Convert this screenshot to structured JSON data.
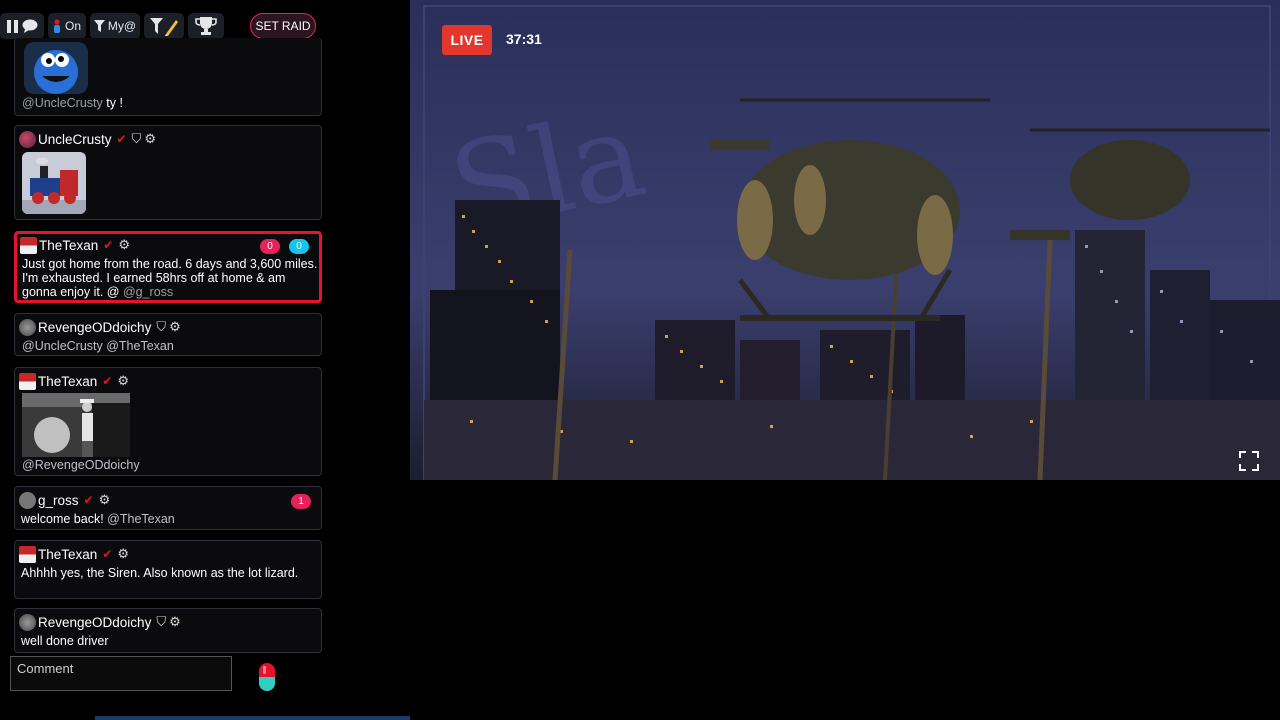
{
  "toolbar": {
    "online_label": "On",
    "mentions_label": "My@",
    "raid_label": "SET RAID"
  },
  "messages": [
    {
      "id": "m0",
      "mention": "@UncleCrusty",
      "text": "ty !"
    },
    {
      "id": "m1",
      "user": "UncleCrusty"
    },
    {
      "id": "m2",
      "user": "TheTexan",
      "text": "Just got home from the road. 6 days and 3,600 miles. I'm exhausted. I earned 58hrs off at home & am gonna enjoy it. @",
      "mention": "@g_ross",
      "badge_red": "0",
      "badge_cyan": "0"
    },
    {
      "id": "m3",
      "user": "RevengeODdoichy",
      "mention": "@UncleCrusty @TheTexan"
    },
    {
      "id": "m4",
      "user": "TheTexan",
      "mention": "@RevengeODdoichy"
    },
    {
      "id": "m5",
      "user": "g_ross",
      "text": "welcome back!",
      "mention": "@TheTexan",
      "badge_red": "1"
    },
    {
      "id": "m6",
      "user": "TheTexan",
      "text": "Ahhhh yes, the Siren. Also known as the lot lizard."
    },
    {
      "id": "m7",
      "user": "RevengeODdoichy",
      "text": "well done driver"
    }
  ],
  "comment": {
    "placeholder": "Comment"
  },
  "video": {
    "live_label": "LIVE",
    "elapsed": "37:31"
  },
  "colors": {
    "accent_red": "#e5132b",
    "live_red": "#e3372e",
    "badge_cyan": "#13c6f0",
    "badge_pink": "#e7215c"
  },
  "icons": {
    "toolbar": [
      "pause-icon",
      "chat-bubble-icon",
      "person-icon",
      "filter-icon",
      "filter-pencil-icon",
      "trophy-icon"
    ],
    "message": [
      "verified-check-icon",
      "shield-icon",
      "gear-icon"
    ],
    "send": "pill-icon",
    "video": "fullscreen-icon"
  }
}
